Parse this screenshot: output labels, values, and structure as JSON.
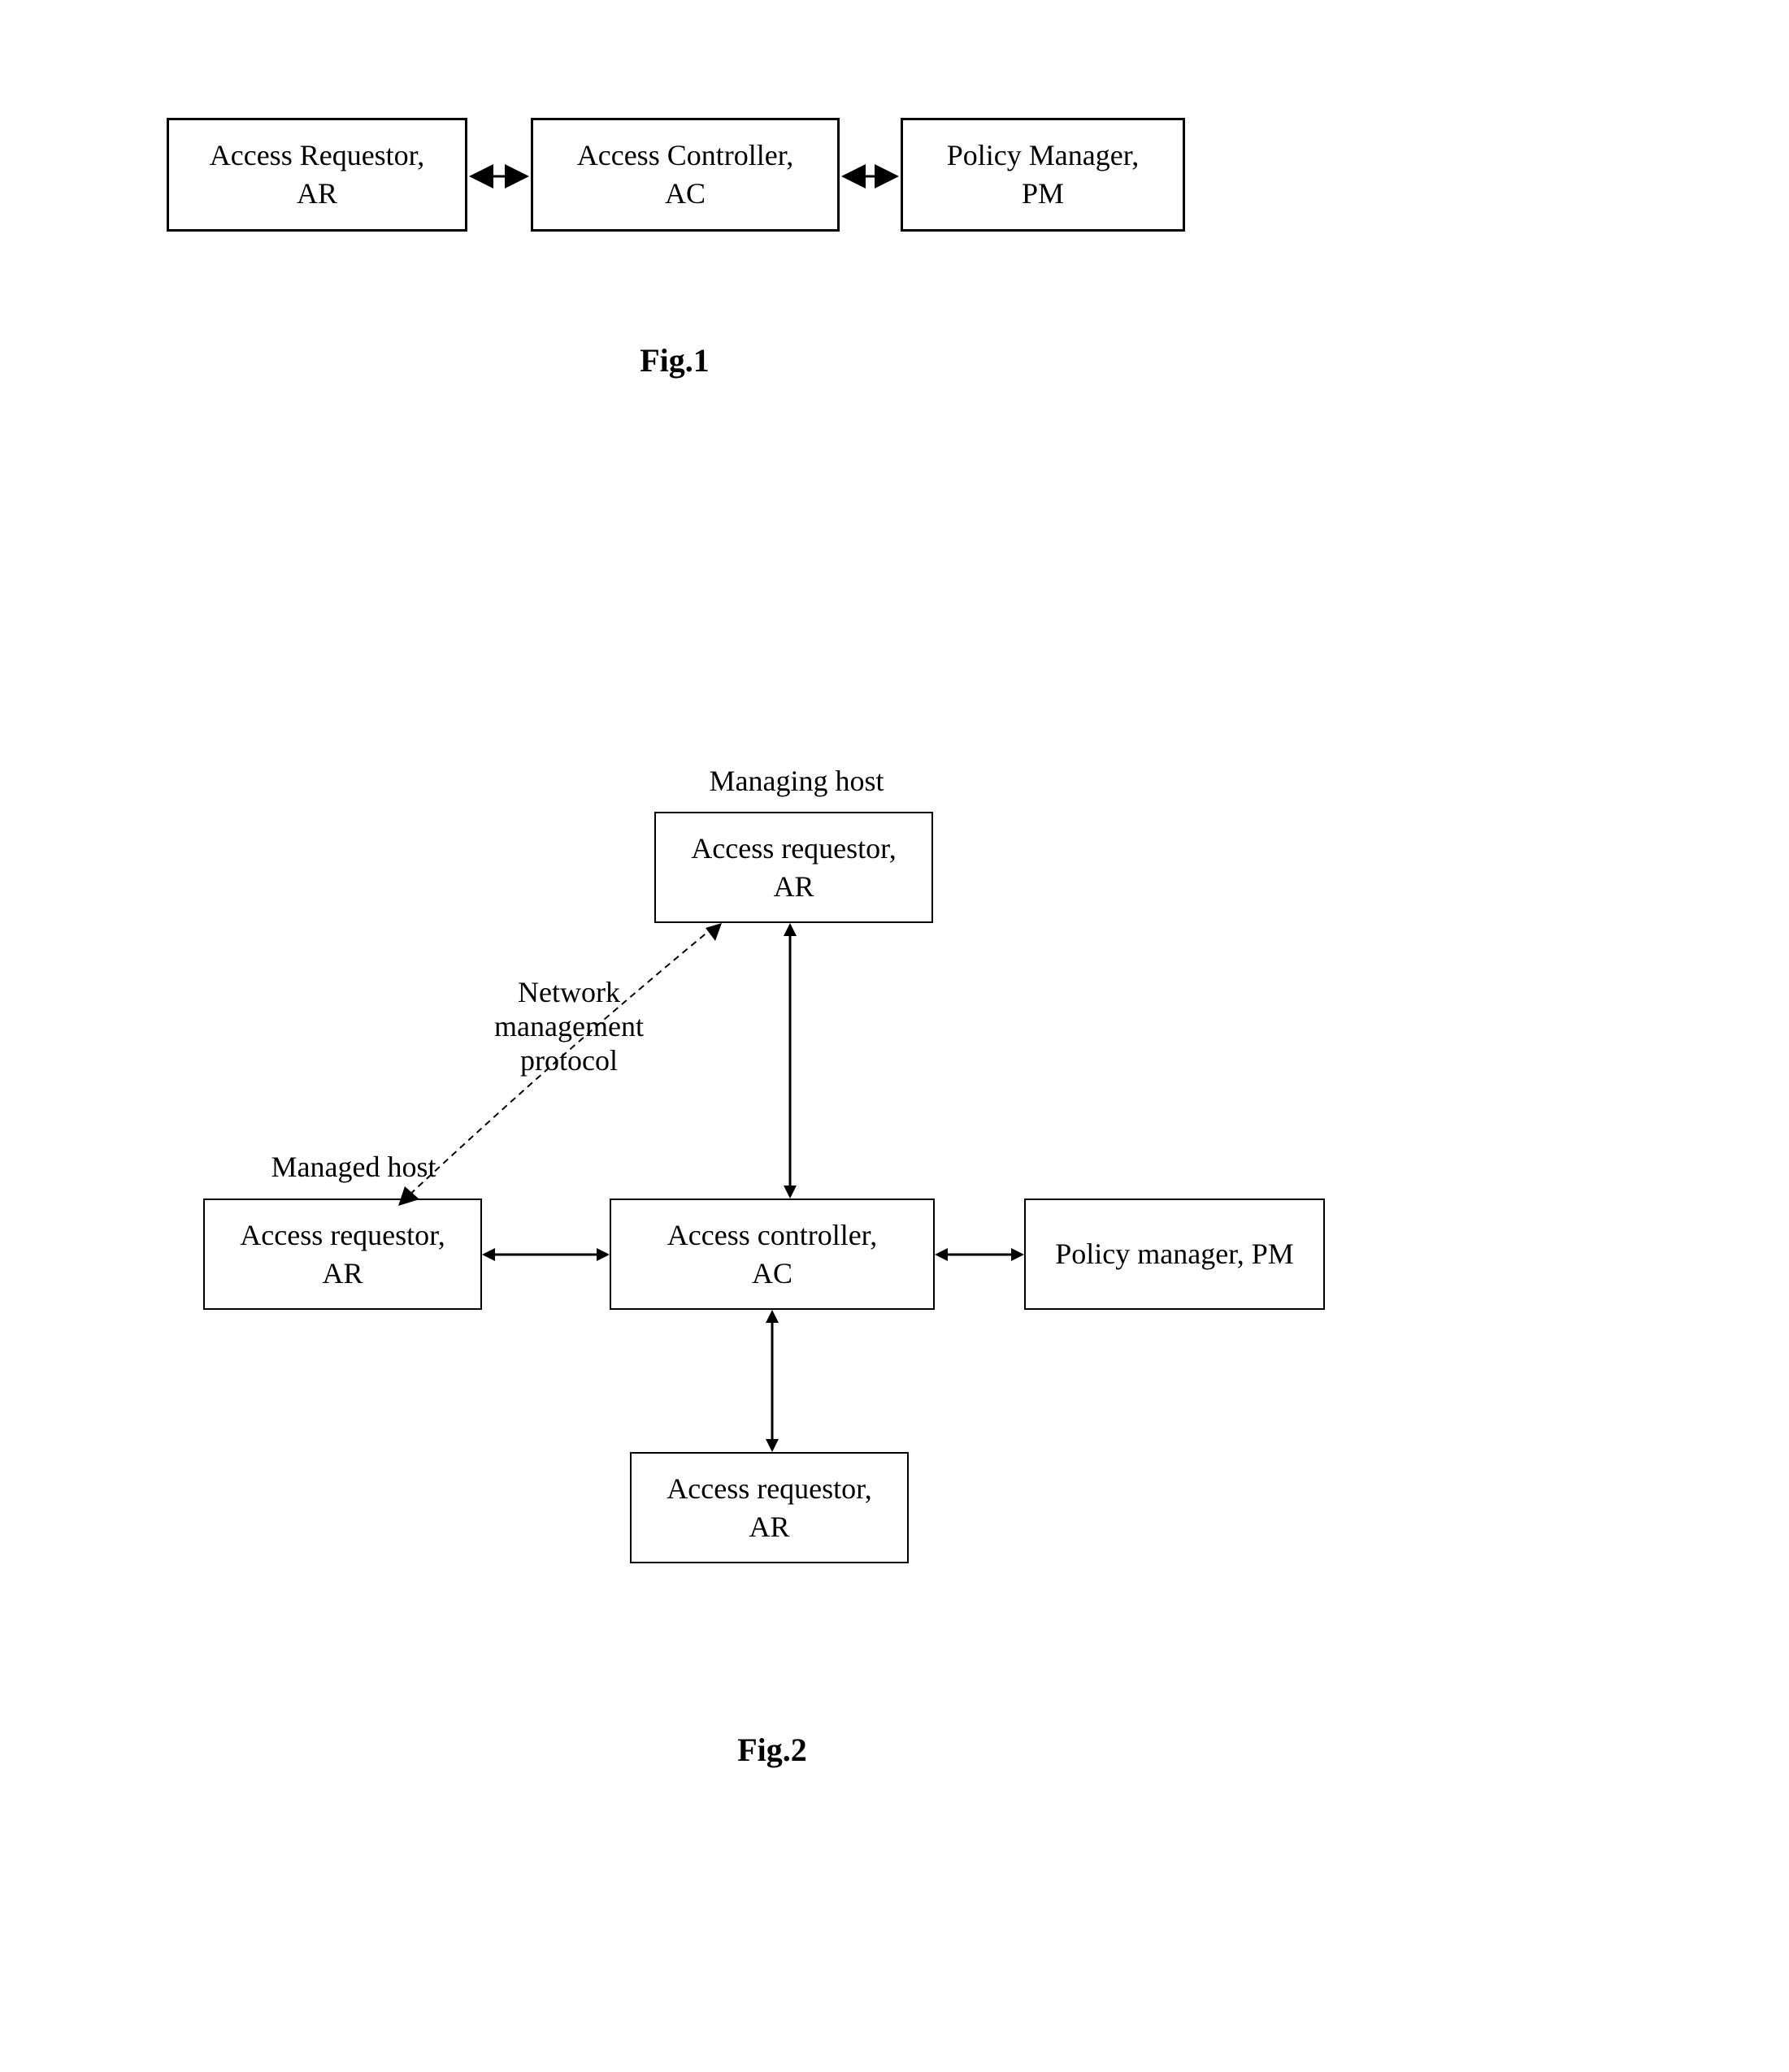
{
  "fig1": {
    "box1": {
      "line1": "Access Requestor,",
      "line2": "AR"
    },
    "box2": {
      "line1": "Access Controller,",
      "line2": "AC"
    },
    "box3": {
      "line1": "Policy Manager,",
      "line2": "PM"
    },
    "caption": "Fig.1"
  },
  "fig2": {
    "managing_host_label": "Managing host",
    "managed_host_label": "Managed host",
    "top_box": {
      "line1": "Access requestor,",
      "line2": "AR"
    },
    "left_box": {
      "line1": "Access requestor,",
      "line2": "AR"
    },
    "center_box": {
      "line1": "Access controller,",
      "line2": "AC"
    },
    "right_box": {
      "line1": "Policy manager, PM"
    },
    "protocol_label": {
      "line1": "Network",
      "line2": "management",
      "line3": "protocol"
    },
    "bottom_box": {
      "line1": "Access requestor,",
      "line2": "AR"
    },
    "caption": "Fig.2"
  }
}
